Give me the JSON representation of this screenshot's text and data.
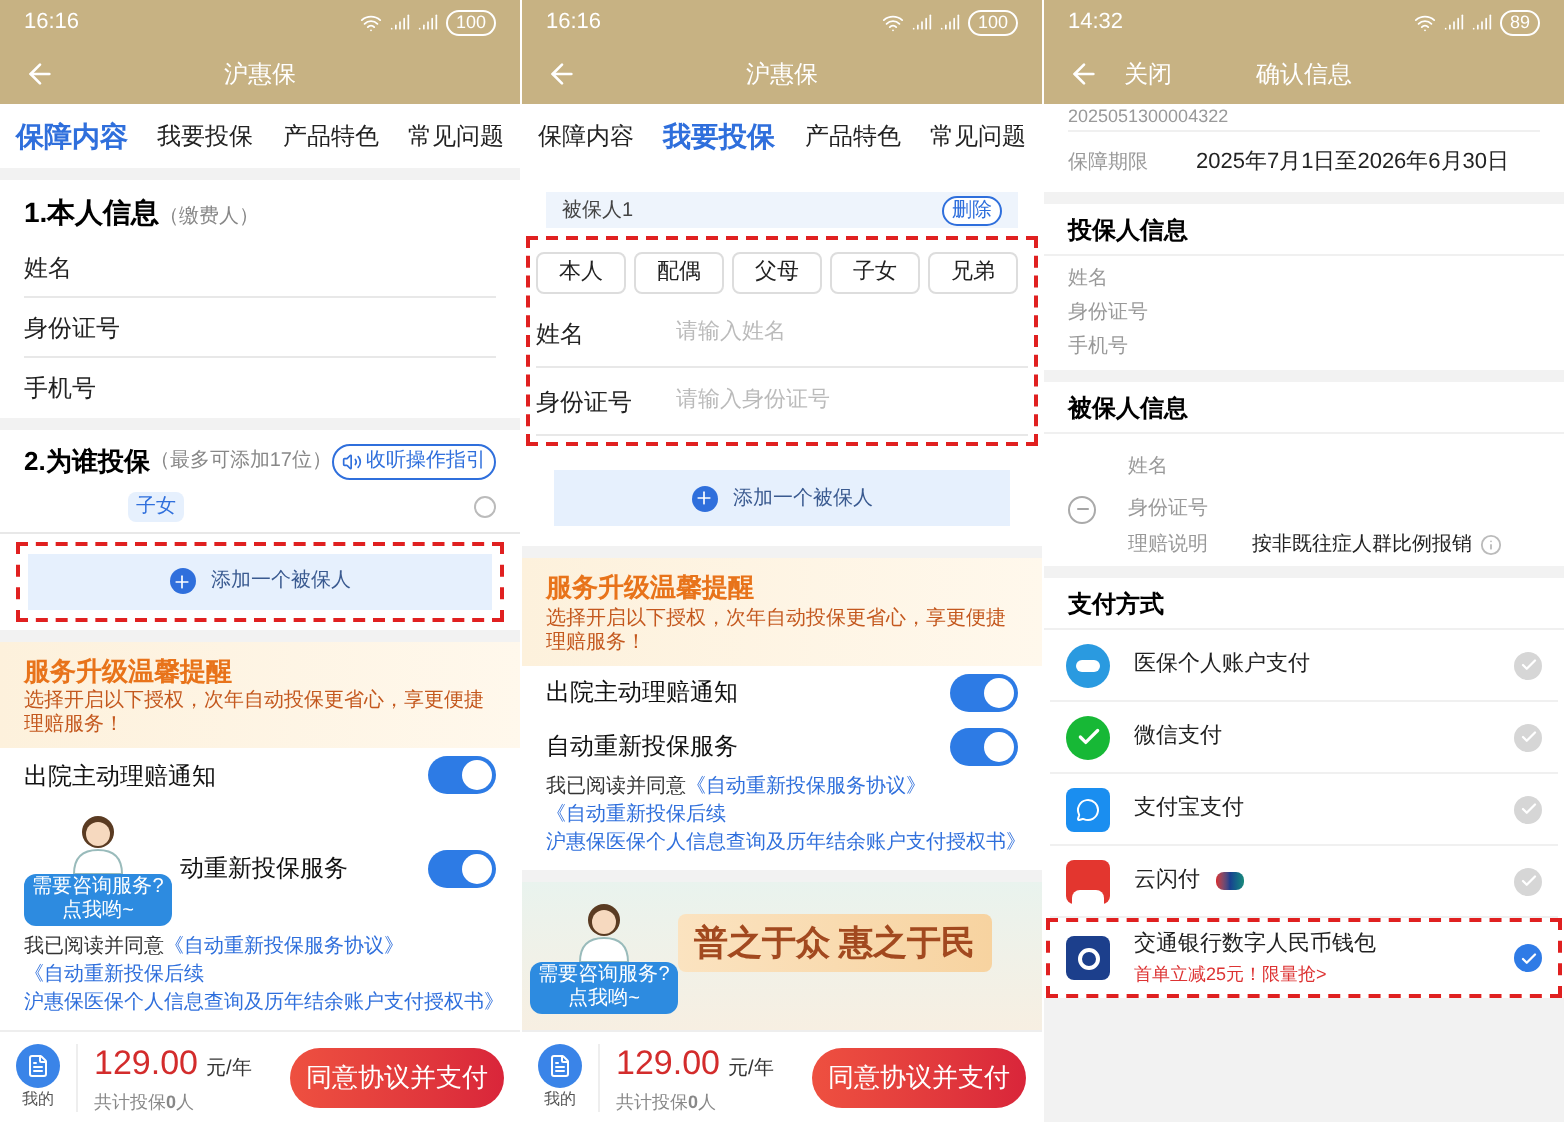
{
  "screens": [
    {
      "kind": "policyholder",
      "status_bar": {
        "time": "16:16",
        "battery": "100"
      },
      "header": {
        "title": "沪惠保"
      },
      "tabs": [
        {
          "label": "保障内容",
          "selected": true
        },
        {
          "label": "我要投保",
          "selected": false
        },
        {
          "label": "产品特色",
          "selected": false
        },
        {
          "label": "常见问题",
          "selected": false
        }
      ],
      "self_section": {
        "heading": "1.本人信息",
        "note": "（缴费人）",
        "fields": [
          "姓名",
          "身份证号",
          "手机号"
        ]
      },
      "insured_section": {
        "heading": "2.为谁投保",
        "note": "（最多可添加17位）",
        "guide_button": "收听操作指引",
        "member": {
          "tag": "子女",
          "selected": false
        }
      },
      "add_button": {
        "label": "添加一个被保人",
        "highlighted": true
      },
      "reminder": {
        "title": "服务升级温馨提醒",
        "subtitle": "选择开启以下授权，次年自动投保更省心，享更便捷理赔服务！"
      },
      "toggles": [
        {
          "label": "出院主动理赔通知",
          "on": true,
          "assistant": false
        },
        {
          "label": "动重新投保服务",
          "on": true,
          "assistant": true
        }
      ],
      "assistant": {
        "line_1": "需要咨询服务?",
        "line_2": "点我哟~"
      },
      "agreement": {
        "prefix": "我已阅读并同意",
        "links": [
          "《自动重新投保服务协议》",
          "《自动重新投保后续",
          "沪惠保医保个人信息查询及历年结余账户支付授权书》"
        ]
      },
      "bottom_bar": {
        "mine": "我的",
        "price": "129.00",
        "unit": "元/年",
        "count": "共计投保**0**人",
        "pay_button": "同意协议并支付"
      }
    },
    {
      "kind": "insured",
      "status_bar": {
        "time": "16:16",
        "battery": "100"
      },
      "header": {
        "title": "沪惠保"
      },
      "tabs": [
        {
          "label": "保障内容",
          "selected": false
        },
        {
          "label": "我要投保",
          "selected": true
        },
        {
          "label": "产品特色",
          "selected": false
        },
        {
          "label": "常见问题",
          "selected": false
        }
      ],
      "insured_card": {
        "label": "被保人1",
        "delete_button": "删除",
        "highlighted": true,
        "relations": [
          {
            "label": "本人",
            "selected": false
          },
          {
            "label": "配偶",
            "selected": false
          },
          {
            "label": "父母",
            "selected": false
          },
          {
            "label": "子女",
            "selected": false
          },
          {
            "label": "兄弟",
            "selected": false
          }
        ],
        "fields": [
          {
            "label": "姓名",
            "placeholder": "请输入姓名"
          },
          {
            "label": "身份证号",
            "placeholder": "请输入身份证号"
          }
        ]
      },
      "add_button": {
        "label": "添加一个被保人",
        "highlighted": false
      },
      "reminder": {
        "title": "服务升级温馨提醒",
        "subtitle": "选择开启以下授权，次年自动投保更省心，享更便捷理赔服务！"
      },
      "toggles": [
        {
          "label": "出院主动理赔通知",
          "on": true,
          "assistant": false
        },
        {
          "label": "自动重新投保服务",
          "on": true,
          "assistant": false
        }
      ],
      "agreement": {
        "prefix": "我已阅读并同意",
        "links": [
          "《自动重新投保服务协议》",
          "《自动重新投保后续",
          "沪惠保医保个人信息查询及历年结余账户支付授权书》"
        ]
      },
      "banner": {
        "title": "普之于众 惠之于民"
      },
      "assistant": {
        "line_1": "需要咨询服务?",
        "line_2": "点我哟~"
      },
      "bottom_bar": {
        "mine": "我的",
        "price": "129.00",
        "unit": "元/年",
        "count": "共计投保**0**人",
        "pay_button": "同意协议并支付"
      }
    },
    {
      "kind": "confirm",
      "status_bar": {
        "time": "14:32",
        "battery": "89"
      },
      "header": {
        "title": "确认信息",
        "close": "关闭"
      },
      "order_number": "2025051300004322",
      "period": {
        "label": "保障期限",
        "value": "2025年7月1日至2026年6月30日"
      },
      "policyholder": {
        "heading": "投保人信息",
        "fields": [
          "姓名",
          "身份证号",
          "手机号"
        ]
      },
      "insured": {
        "heading": "被保人信息",
        "name_label": "姓名",
        "id_label": "身份证号",
        "claim_label": "理赔说明",
        "claim_value": "按非既往症人群比例报销"
      },
      "payment": {
        "heading": "支付方式",
        "methods": [
          {
            "kind": "medical",
            "label": "医保个人账户支付",
            "selected": false,
            "highlighted": false
          },
          {
            "kind": "wechat",
            "label": "微信支付",
            "selected": false,
            "highlighted": false
          },
          {
            "kind": "alipay",
            "label": "支付宝支付",
            "selected": false,
            "highlighted": false
          },
          {
            "kind": "unionpay",
            "label": "云闪付",
            "selected": false,
            "highlighted": false
          },
          {
            "kind": "bank",
            "label": "交通银行数字人民币钱包",
            "promo": "首单立减25元！限量抢>",
            "selected": true,
            "highlighted": true
          }
        ]
      }
    }
  ]
}
